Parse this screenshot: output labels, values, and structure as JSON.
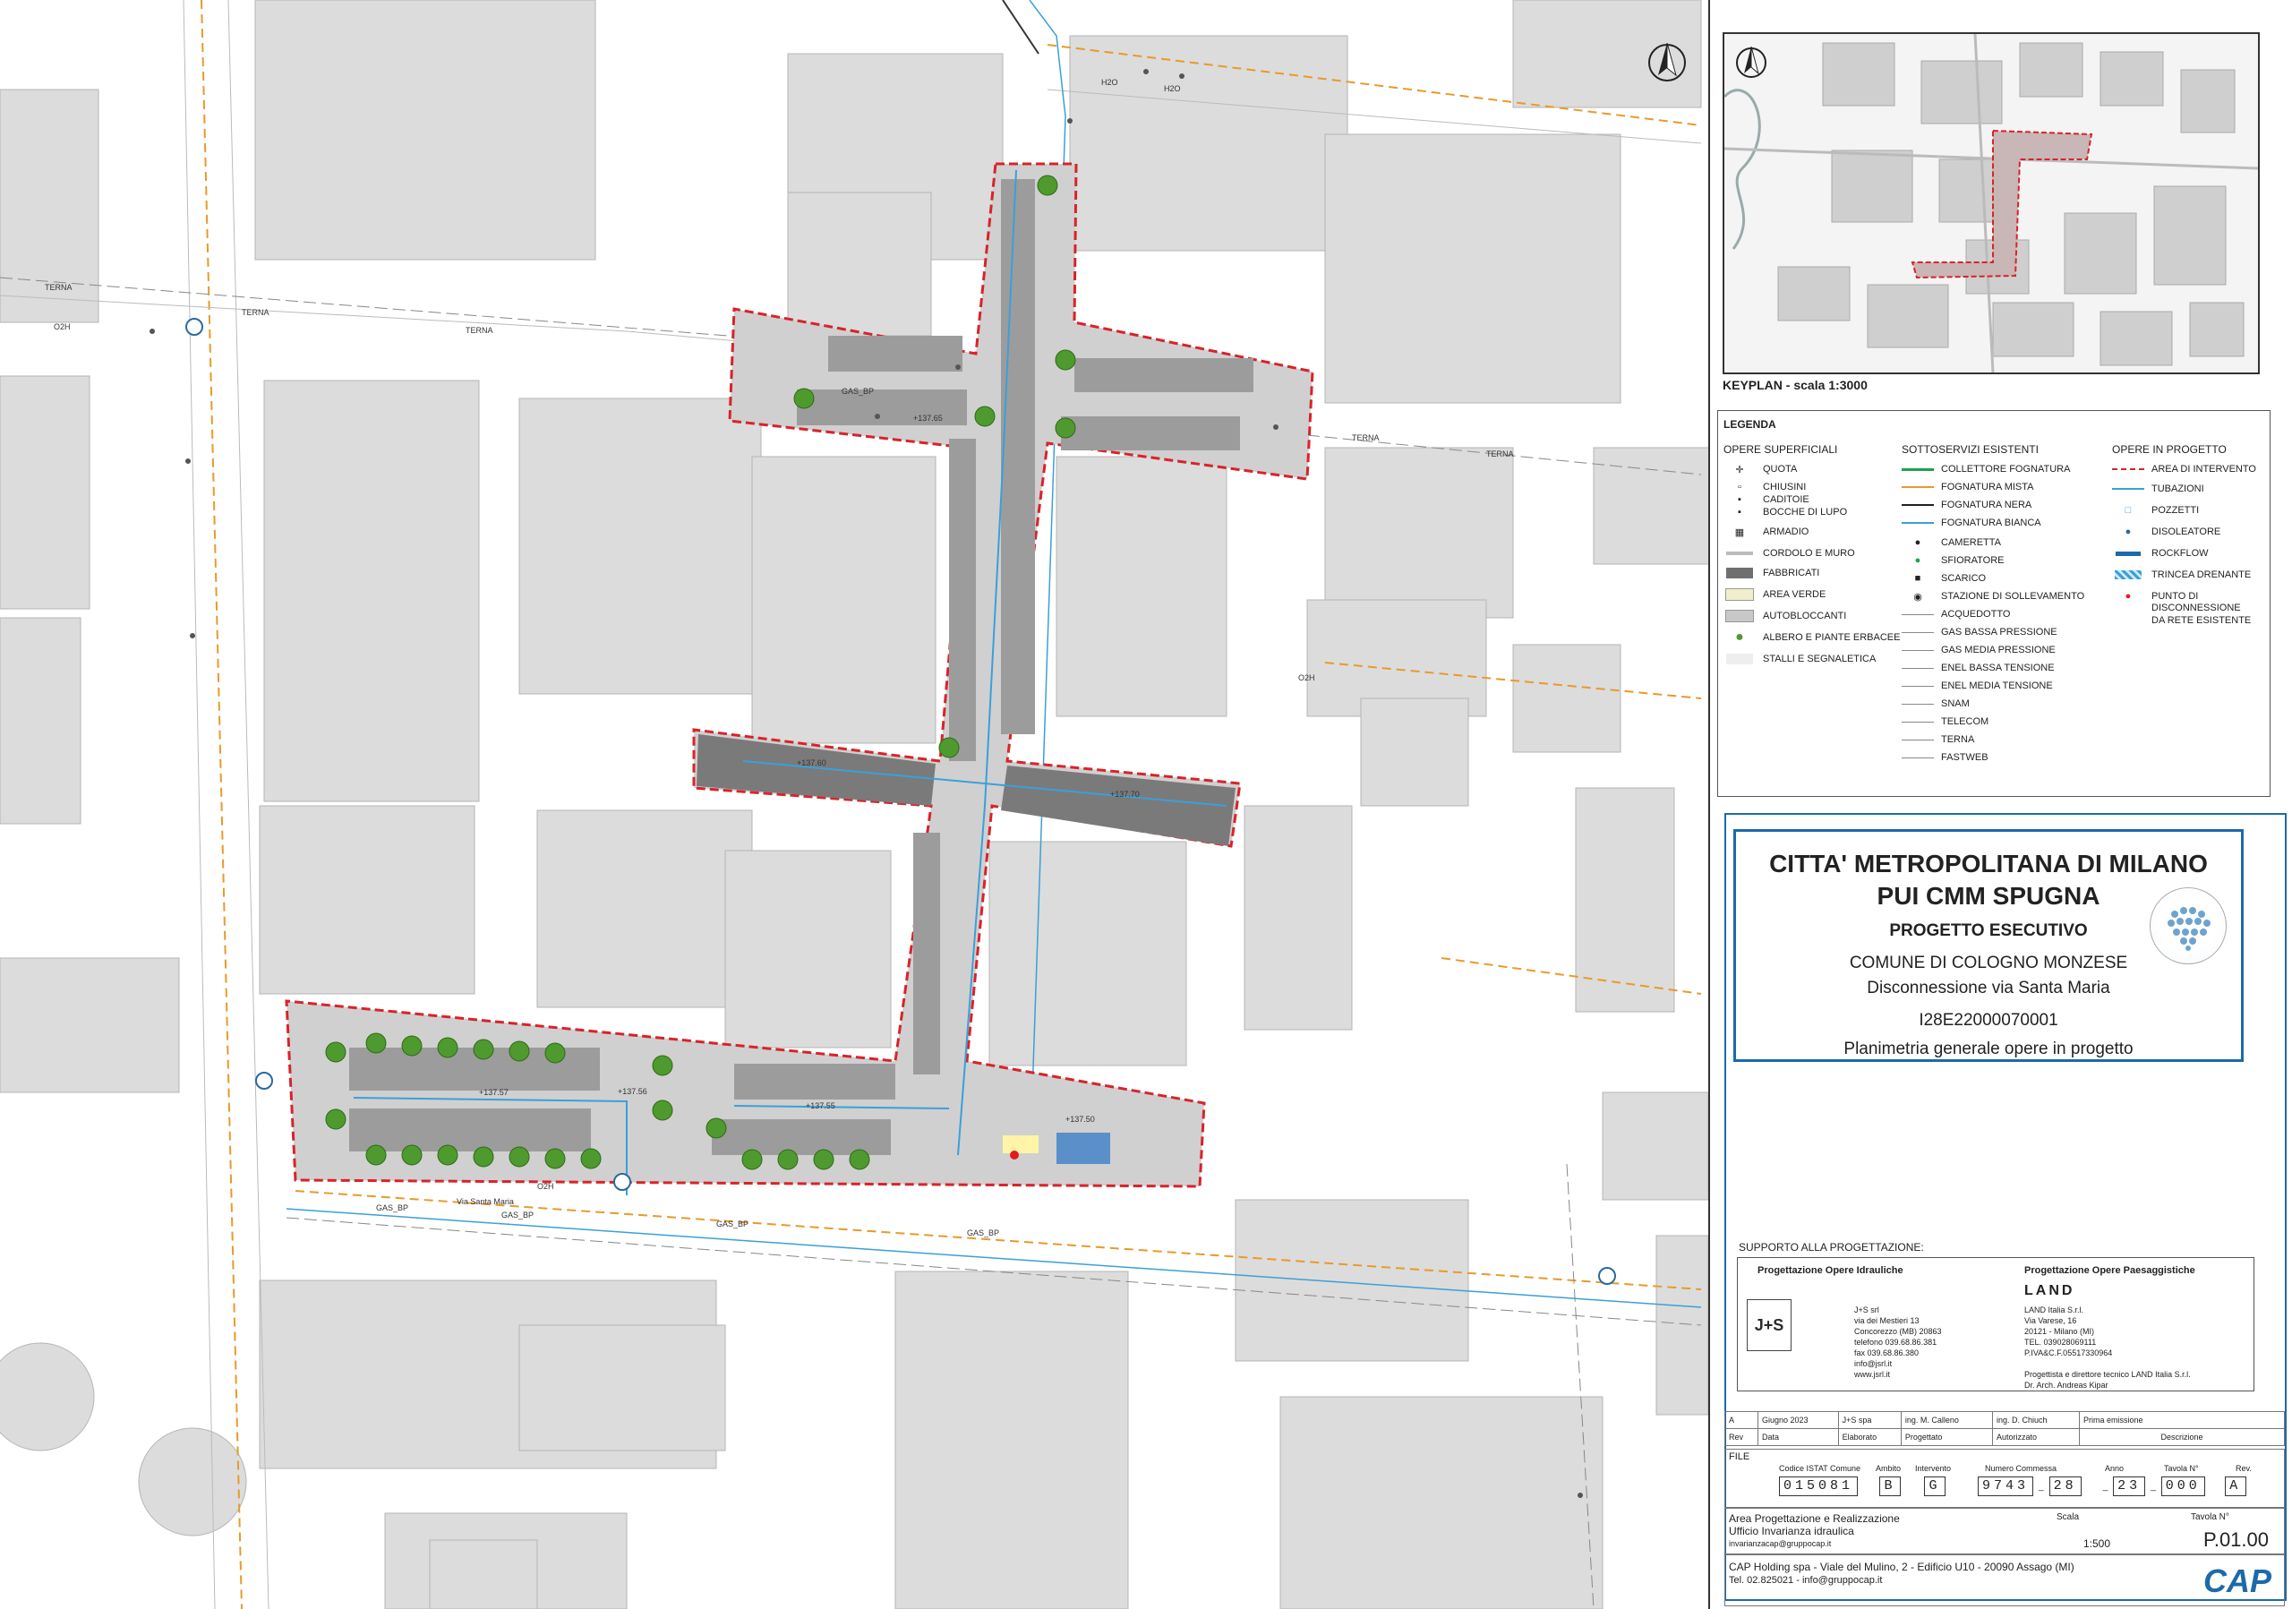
{
  "map": {
    "labels": {
      "terna": "TERNA",
      "o2h": "O2H",
      "h2o": "H2O",
      "gas_bp": "GAS_BP",
      "via_santa_maria": "Via Santa Maria"
    },
    "spot_heights": [
      "+137.57",
      "+137.56",
      "+137.55",
      "+137.50",
      "+137.60",
      "+137.70",
      "+137.65"
    ]
  },
  "keyplan": {
    "title": "KEYPLAN - scala 1:3000"
  },
  "legend": {
    "title": "LEGENDA",
    "col1_title": "OPERE SUPERFICIALI",
    "col2_title": "SOTTOSERVIZI ESISTENTI",
    "col3_title": "OPERE IN PROGETTO",
    "col1": [
      "QUOTA",
      "CHIUSINI",
      "CADITOIE",
      "BOCCHE DI LUPO",
      "ARMADIO",
      "CORDOLO E MURO",
      "FABBRICATI",
      "AREA VERDE",
      "AUTOBLOCCANTI",
      "ALBERO E PIANTE ERBACEE",
      "STALLI E SEGNALETICA"
    ],
    "col2": [
      "COLLETTORE FOGNATURA",
      "FOGNATURA MISTA",
      "FOGNATURA NERA",
      "FOGNATURA BIANCA",
      "CAMERETTA",
      "SFIORATORE",
      "SCARICO",
      "STAZIONE DI SOLLEVAMENTO",
      "ACQUEDOTTO",
      "GAS BASSA PRESSIONE",
      "GAS MEDIA PRESSIONE",
      "ENEL BASSA TENSIONE",
      "ENEL MEDIA TENSIONE",
      "SNAM",
      "TELECOM",
      "TERNA",
      "FASTWEB"
    ],
    "col3": [
      "AREA DI INTERVENTO",
      "TUBAZIONI",
      "POZZETTI",
      "DISOLEATORE",
      "ROCKFLOW",
      "TRINCEA DRENANTE",
      "PUNTO DI",
      "DISCONNESSIONE",
      "DA RETE ESISTENTE"
    ]
  },
  "title_block": {
    "line1": "CITTA' METROPOLITANA DI MILANO",
    "line2": "PUI CMM SPUGNA",
    "line3": "PROGETTO ESECUTIVO",
    "line4": "COMUNE DI COLOGNO MONZESE",
    "line5": "Disconnessione via Santa Maria",
    "line6": "I28E22000070001",
    "line7": "Planimetria generale opere in progetto"
  },
  "support": {
    "label": "SUPPORTO ALLA PROGETTAZIONE:",
    "hydraulic_title": "Progettazione Opere Idrauliche",
    "hydraulic_logo": "J+S",
    "hydraulic_lines": [
      "J+S srl",
      "via dei Mestieri 13",
      "Concorezzo (MB) 20863",
      "telefono 039.68.86.381",
      "fax 039.68.86.380",
      "info@jsrl.it",
      "www.jsrl.it"
    ],
    "landscape_title": "Progettazione Opere Paesaggistiche",
    "landscape_logo": "LAND",
    "landscape_lines": [
      "LAND Italia S.r.l.",
      "Via Varese, 16",
      "20121 - Milano (MI)",
      "TEL. 039028069111",
      "P.IVA&C.F.05517330964",
      "",
      "Progettista e direttore tecnico LAND Italia S.r.l.",
      "Dr. Arch. Andreas Kipar"
    ]
  },
  "revision": {
    "rows": [
      [
        "A",
        "Giugno 2023",
        "J+S spa",
        "ing. M. Calleno",
        "ing. D. Chiuch",
        "Prima emissione"
      ],
      [
        "Rev",
        "Data",
        "Elaborato",
        "Progettato",
        "Autorizzato",
        "Descrizione"
      ]
    ]
  },
  "file": {
    "label": "FILE",
    "istat_label": "Codice ISTAT Comune",
    "ambito_label": "Ambito",
    "intervento_label": "Intervento",
    "commessa_label": "Numero Commessa",
    "anno_label": "Anno",
    "tavola_label": "Tavola N°",
    "rev_label": "Rev.",
    "istat": "015081",
    "ambito": "B",
    "intervento": "G",
    "commessa_a": "9743",
    "commessa_b": "28",
    "anno": "23",
    "tavola": "000",
    "rev": "A",
    "sep": "_"
  },
  "area": {
    "line1": "Area Progettazione e Realizzazione",
    "line2": "Ufficio Invarianza idraulica",
    "email": "invarianzacap@gruppocap.it",
    "scala_label": "Scala",
    "scala": "1:500",
    "tavola_label": "Tavola N°",
    "tavola": "P.01.00"
  },
  "company": {
    "line1": "CAP Holding spa - Viale del Mulino, 2 - Edificio U10 - 20090 Assago (MI)",
    "line2": "Tel. 02.825021 - info@gruppocap.it",
    "logo": "CAP"
  },
  "colors": {
    "intervention_border": "#d8232a",
    "pipe": "#3aa0d8",
    "utility_orange": "#e89a2a",
    "building": "#d9d9d9",
    "road_grey": "#8a8a8a",
    "parking": "#a8a8a8",
    "green": "#4f9a2e",
    "frame_blue": "#1c6aa9"
  }
}
